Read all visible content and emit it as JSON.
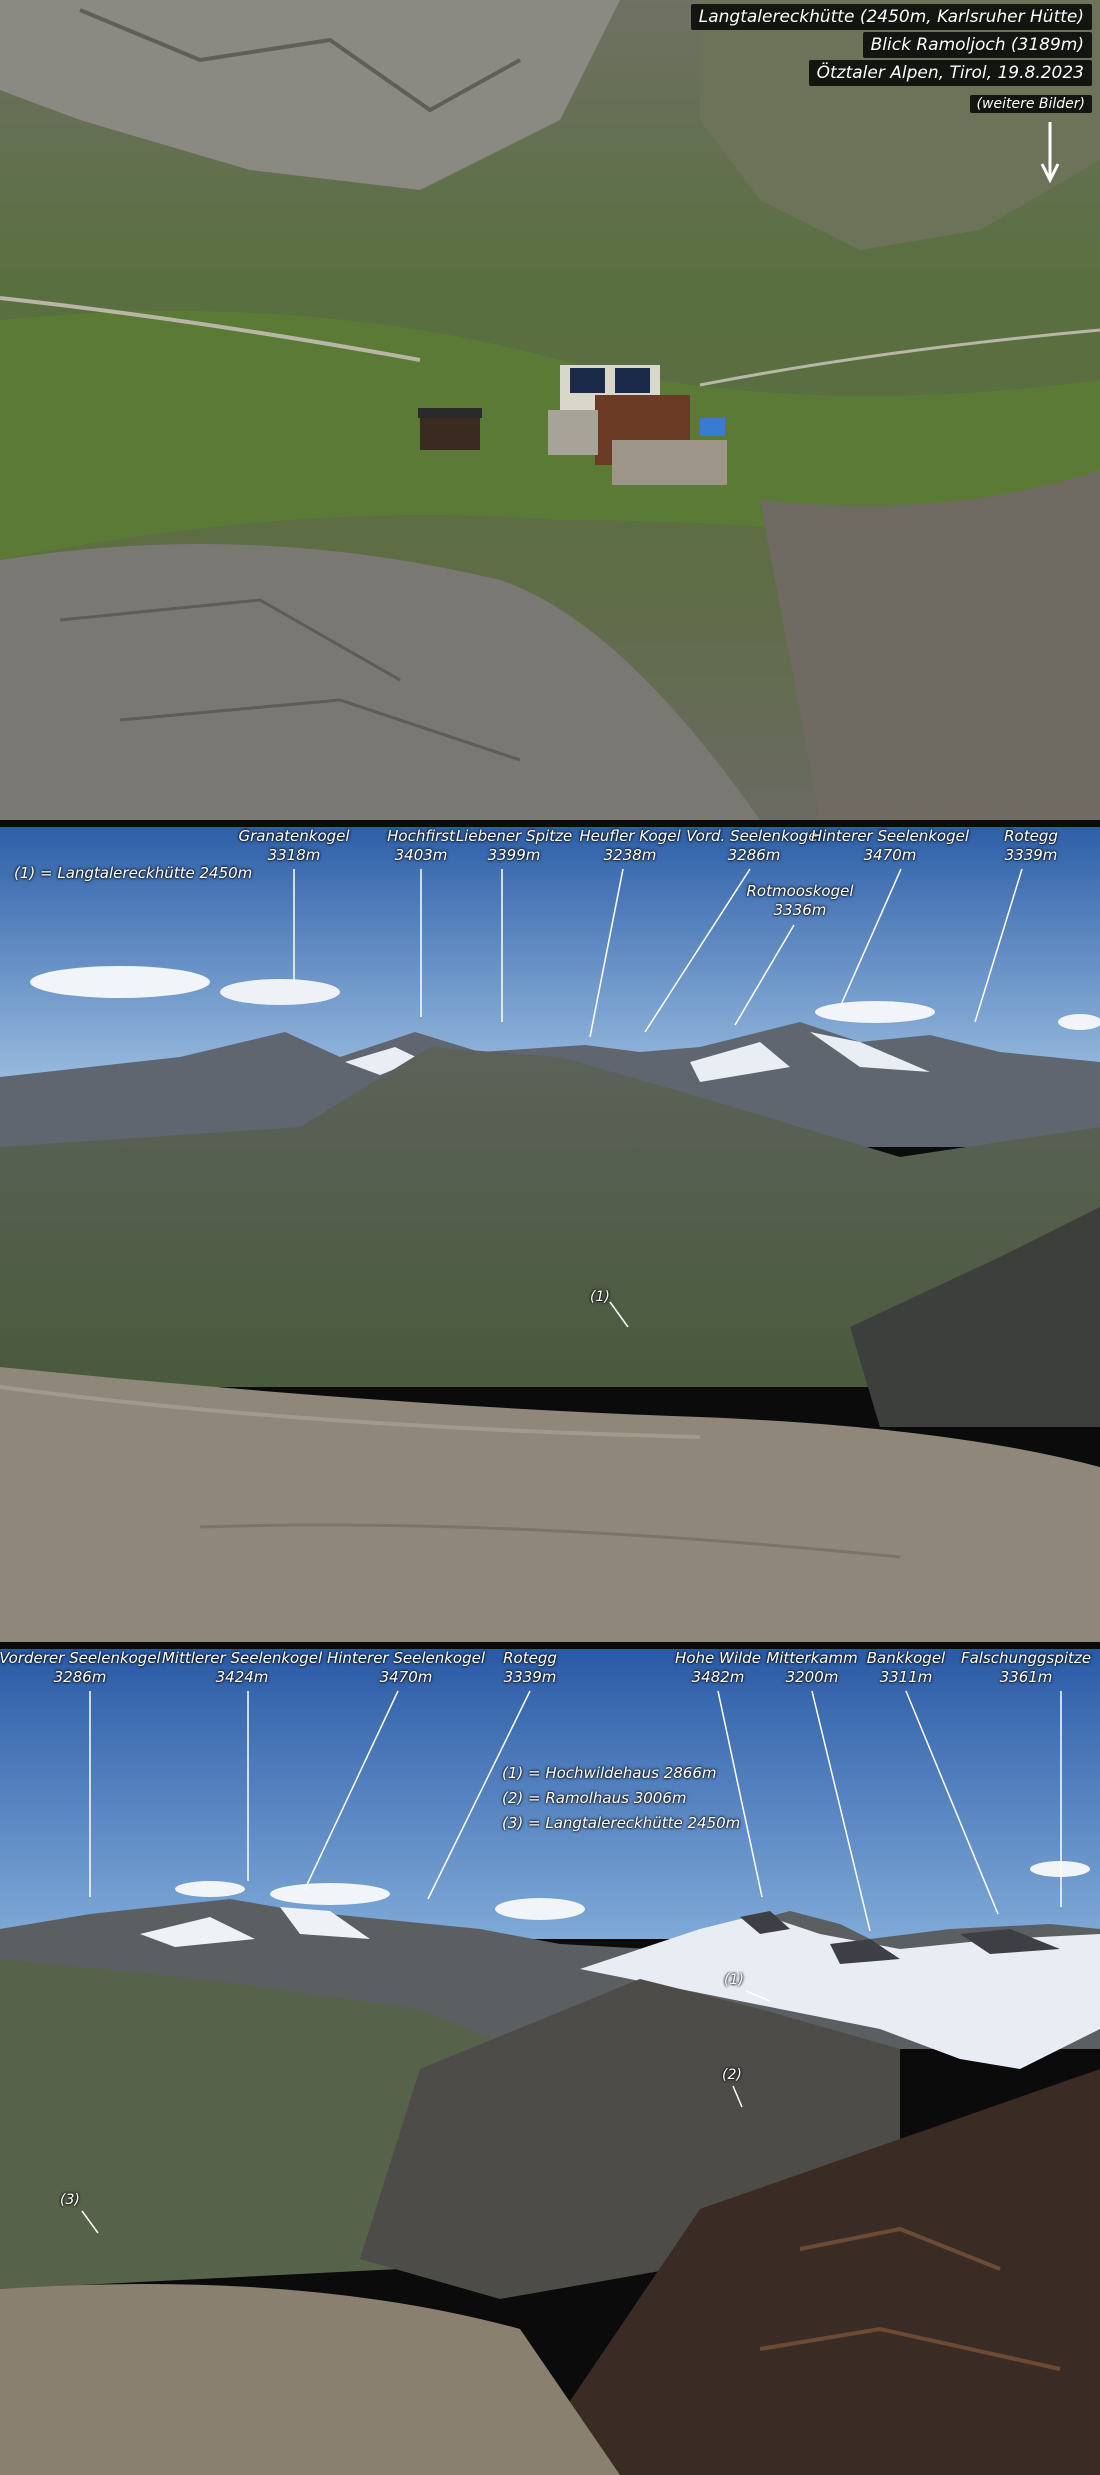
{
  "top": {
    "caption_lines": [
      "Langtalereckhütte (2450m, Karlsruher Hütte)",
      "Blick Ramoljoch (3189m)",
      "Ötztaler Alpen, Tirol, 19.8.2023"
    ],
    "more_link": "(weitere Bilder)",
    "arrow_icon": "arrow-down-icon"
  },
  "middle": {
    "legend": "(1) = Langtalereckhütte 2450m",
    "peaks": [
      {
        "name": "Granatenkogel",
        "alt": "3318m"
      },
      {
        "name": "Hochfirst",
        "alt": "3403m"
      },
      {
        "name": "Liebener Spitze",
        "alt": "3399m"
      },
      {
        "name": "Heufler Kogel",
        "alt": "3238m"
      },
      {
        "name": "Vord. Seelenkogel",
        "alt": "3286m"
      },
      {
        "name": "Hinterer Seelenkogel",
        "alt": "3470m"
      },
      {
        "name": "Rotegg",
        "alt": "3339m"
      },
      {
        "name": "Rotmooskogel",
        "alt": "3336m"
      }
    ],
    "markers": [
      "(1)"
    ]
  },
  "bottom": {
    "legend": [
      "(1) = Hochwildehaus 2866m",
      "(2) = Ramolhaus 3006m",
      "(3) = Langtalereckhütte 2450m"
    ],
    "peaks": [
      {
        "name": "Vorderer Seelenkogel",
        "alt": "3286m"
      },
      {
        "name": "Mittlerer Seelenkogel",
        "alt": "3424m"
      },
      {
        "name": "Hinterer Seelenkogel",
        "alt": "3470m"
      },
      {
        "name": "Rotegg",
        "alt": "3339m"
      },
      {
        "name": "Hohe Wilde",
        "alt": "3482m"
      },
      {
        "name": "Mitterkamm",
        "alt": "3200m"
      },
      {
        "name": "Bankkogel",
        "alt": "3311m"
      },
      {
        "name": "Falschunggspitze",
        "alt": "3361m"
      }
    ],
    "markers": [
      "(1)",
      "(2)",
      "(3)"
    ]
  },
  "colors": {
    "sky_top": "#2d5fa8",
    "sky_bottom": "#8fb3d9",
    "grass": "#5b7a3c",
    "rock": "#7d7a72",
    "hut_roof": "#6b3a24",
    "label": "#ffffff"
  }
}
